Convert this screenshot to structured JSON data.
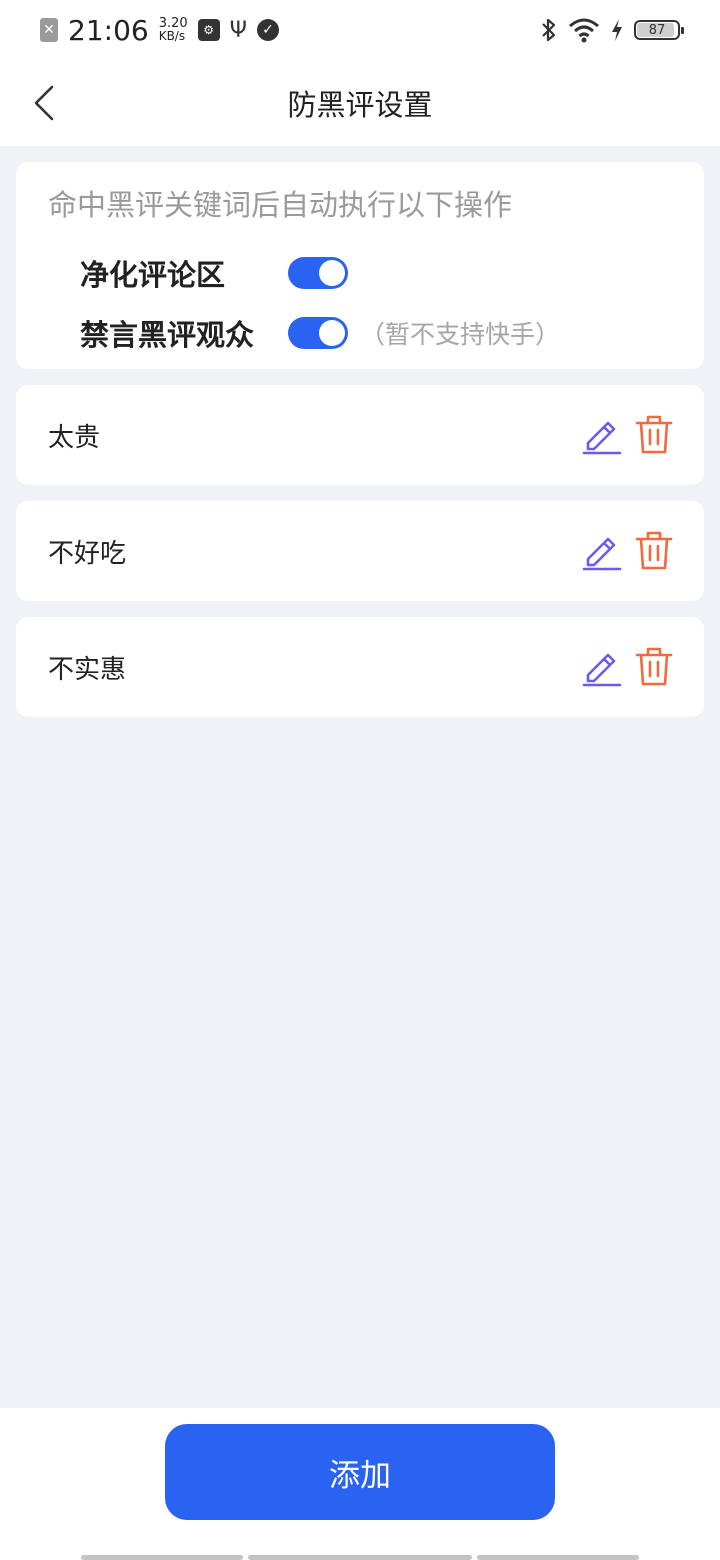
{
  "status_bar": {
    "sim_icon": "✕",
    "time": "21:06",
    "speed_value": "3.20",
    "speed_unit": "KB/s",
    "battery": "87"
  },
  "nav": {
    "title": "防黑评设置"
  },
  "settings": {
    "description": "命中黑评关键词后自动执行以下操作",
    "options": [
      {
        "label": "净化评论区",
        "enabled": true,
        "note": ""
      },
      {
        "label": "禁言黑评观众",
        "enabled": true,
        "note": "（暂不支持快手）"
      }
    ]
  },
  "keywords": [
    {
      "text": "太贵"
    },
    {
      "text": "不好吃"
    },
    {
      "text": "不实惠"
    }
  ],
  "actions": {
    "add_label": "添加"
  },
  "colors": {
    "accent": "#2a63f2",
    "edit_icon": "#6a5cf0",
    "delete_icon": "#f06a3e",
    "background": "#eff3f8"
  }
}
